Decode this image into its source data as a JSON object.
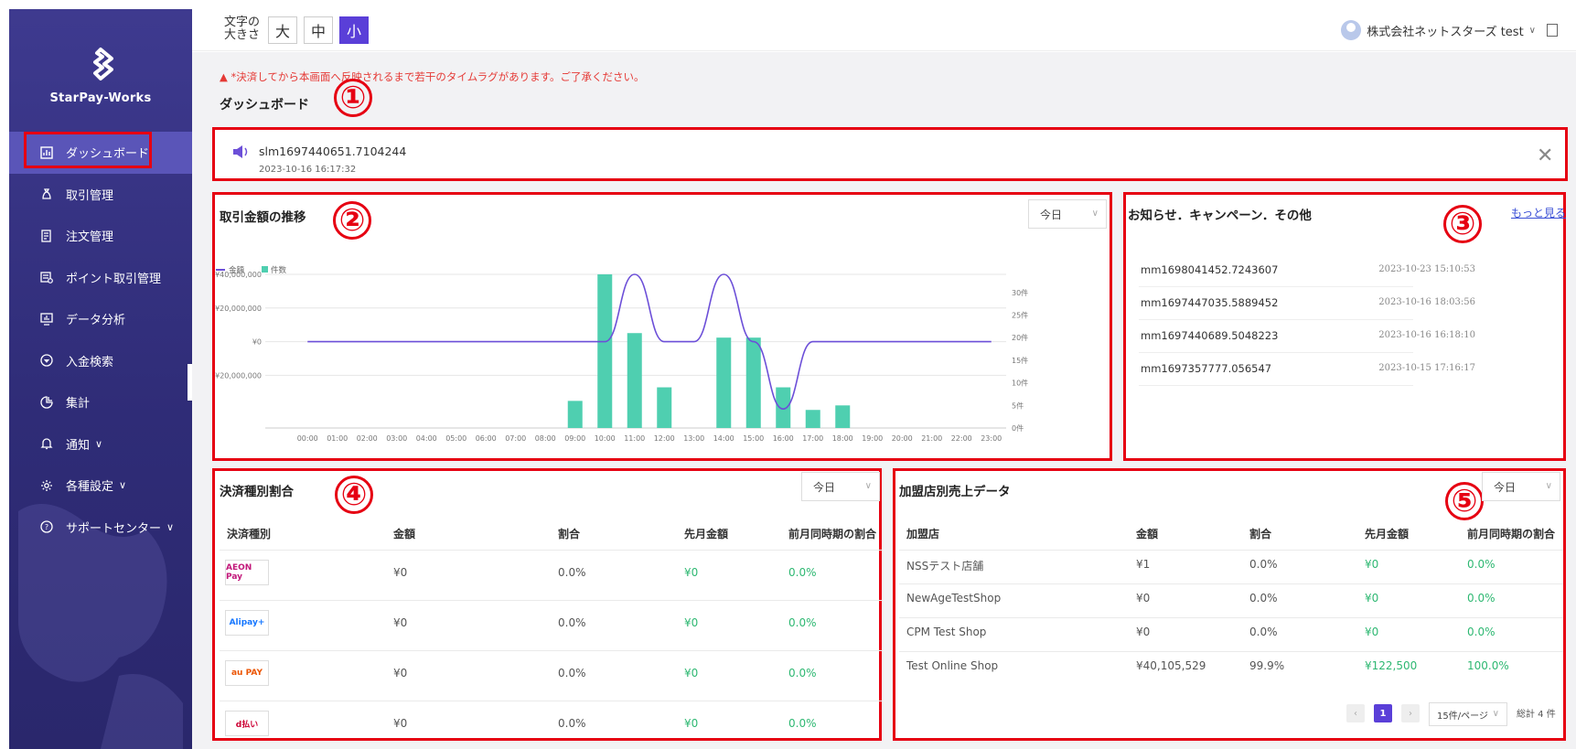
{
  "app": {
    "brand": "StarPay-Works"
  },
  "sidebar": {
    "items": [
      {
        "label": "ダッシュボード",
        "icon": "bar-chart-icon"
      },
      {
        "label": "取引管理",
        "icon": "money-bag-icon"
      },
      {
        "label": "注文管理",
        "icon": "order-doc-icon"
      },
      {
        "label": "ポイント取引管理",
        "icon": "points-icon"
      },
      {
        "label": "データ分析",
        "icon": "monitor-chart-icon"
      },
      {
        "label": "入金検索",
        "icon": "deposit-icon"
      },
      {
        "label": "集計",
        "icon": "pie-chart-icon"
      },
      {
        "label": "通知",
        "icon": "bell-icon"
      },
      {
        "label": "各種設定",
        "icon": "gear-icon"
      },
      {
        "label": "サポートセンター",
        "icon": "help-icon"
      }
    ]
  },
  "topbar": {
    "font_size_label": "文字の\n大きさ",
    "sizes": [
      "大",
      "中",
      "小"
    ],
    "user": "株式会社ネットスターズ test"
  },
  "notice": "*決済してから本画面へ反映されるまで若干のタイムラグがあります。ご了承ください。",
  "page_title": "ダッシュボード",
  "markers": [
    "①",
    "②",
    "③",
    "④",
    "⑤"
  ],
  "announcement": {
    "text": "slm1697440651.7104244",
    "date": "2023-10-16 16:17:32"
  },
  "trend": {
    "title": "取引金額の推移",
    "range": "今日",
    "legend": [
      "金額",
      "件数"
    ]
  },
  "chart_data": {
    "type": "bar",
    "categories": [
      "00:00",
      "01:00",
      "02:00",
      "03:00",
      "04:00",
      "05:00",
      "06:00",
      "07:00",
      "08:00",
      "09:00",
      "10:00",
      "11:00",
      "12:00",
      "13:00",
      "14:00",
      "15:00",
      "16:00",
      "17:00",
      "18:00",
      "19:00",
      "20:00",
      "21:00",
      "22:00",
      "23:00"
    ],
    "series": [
      {
        "name": "件数",
        "axis": "right",
        "values": [
          0,
          0,
          0,
          0,
          0,
          0,
          0,
          0,
          0,
          6,
          34,
          21,
          9,
          0,
          20,
          20,
          9,
          4,
          5,
          0,
          0,
          0,
          0,
          0
        ]
      },
      {
        "name": "金額",
        "axis": "left",
        "type": "line",
        "values": [
          0,
          0,
          0,
          0,
          0,
          0,
          0,
          0,
          0,
          0,
          0,
          40000000,
          0,
          0,
          40000000,
          0,
          -40000000,
          0,
          0,
          0,
          0,
          0,
          0,
          0
        ]
      }
    ],
    "y_left_ticks": [
      "¥40,000,000",
      "¥20,000,000",
      "¥0",
      "- ¥20,000,000"
    ],
    "y_right_ticks": [
      "30件",
      "25件",
      "20件",
      "15件",
      "10件",
      "5件",
      "0件"
    ],
    "ylim_left": [
      -40000000,
      40000000
    ],
    "ylim_right": [
      0,
      34
    ],
    "colors": {
      "bar": "#4fcfb0",
      "line": "#6c4fd8"
    }
  },
  "news": {
    "title": "お知らせ．キャンペーン．その他",
    "more": "もっと見る",
    "items": [
      {
        "title": "mm1698041452.7243607",
        "date": "2023-10-23 15:10:53"
      },
      {
        "title": "mm1697447035.5889452",
        "date": "2023-10-16 18:03:56"
      },
      {
        "title": "mm1697440689.5048223",
        "date": "2023-10-16 16:18:10"
      },
      {
        "title": "mm1697357777.056547",
        "date": "2023-10-15 17:16:17"
      }
    ]
  },
  "payment": {
    "title": "決済種別割合",
    "range": "今日",
    "headers": [
      "決済種別",
      "金額",
      "割合",
      "先月金額",
      "前月同時期の割合"
    ],
    "rows": [
      {
        "logo": "AEON Pay",
        "amount": "¥0",
        "ratio": "0.0%",
        "last": "¥0",
        "last_ratio": "0.0%"
      },
      {
        "logo": "Alipay+",
        "amount": "¥0",
        "ratio": "0.0%",
        "last": "¥0",
        "last_ratio": "0.0%"
      },
      {
        "logo": "au PAY",
        "amount": "¥0",
        "ratio": "0.0%",
        "last": "¥0",
        "last_ratio": "0.0%"
      },
      {
        "logo": "d払い",
        "amount": "¥0",
        "ratio": "0.0%",
        "last": "¥0",
        "last_ratio": "0.0%"
      }
    ]
  },
  "shops": {
    "title": "加盟店別売上データ",
    "range": "今日",
    "headers": [
      "加盟店",
      "金額",
      "割合",
      "先月金額",
      "前月同時期の割合"
    ],
    "rows": [
      {
        "name": "NSSテスト店舗",
        "amount": "¥1",
        "ratio": "0.0%",
        "last": "¥0",
        "last_ratio": "0.0%"
      },
      {
        "name": "NewAgeTestShop",
        "amount": "¥0",
        "ratio": "0.0%",
        "last": "¥0",
        "last_ratio": "0.0%"
      },
      {
        "name": "CPM Test Shop",
        "amount": "¥0",
        "ratio": "0.0%",
        "last": "¥0",
        "last_ratio": "0.0%"
      },
      {
        "name": "Test Online Shop",
        "amount": "¥40,105,529",
        "ratio": "99.9%",
        "last": "¥122,500",
        "last_ratio": "100.0%"
      }
    ],
    "pager": {
      "page": "1",
      "per_page": "15件/ページ",
      "total": "総計 4 件"
    }
  }
}
